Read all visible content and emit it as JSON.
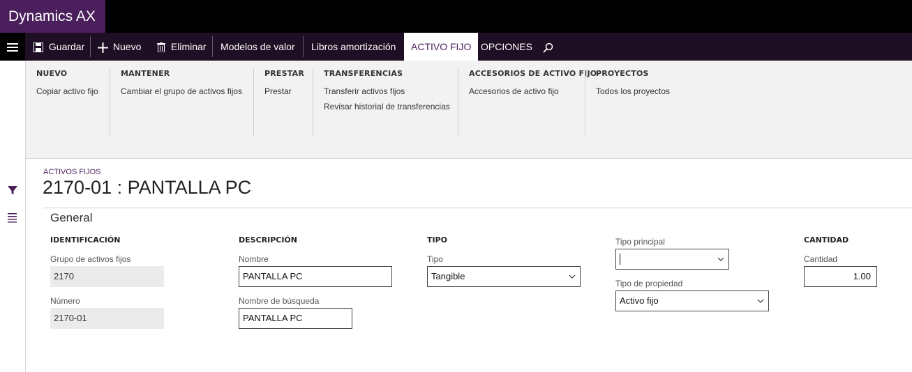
{
  "app": {
    "title": "Dynamics AX"
  },
  "toolbar": {
    "save_label": "Guardar",
    "new_label": "Nuevo",
    "delete_label": "Eliminar",
    "value_models_label": "Modelos de valor",
    "depreciation_books_label": "Libros amortización",
    "tab_active_label": "ACTIVO FIJO",
    "tab_options_label": "OPCIONES"
  },
  "ribbon": {
    "groups": [
      {
        "header": "NUEVO",
        "items": [
          "Copiar activo fijo"
        ]
      },
      {
        "header": "MANTENER",
        "items": [
          "Cambiar el grupo de activos fijos"
        ]
      },
      {
        "header": "PRESTAR",
        "items": [
          "Prestar"
        ]
      },
      {
        "header": "TRANSFERENCIAS",
        "items": [
          "Transferir activos fijos",
          "Revisar historial de transferencias"
        ]
      },
      {
        "header": "ACCESORIOS DE ACTIVO FIJO",
        "items": [
          "Accesorios de activo fijo"
        ]
      },
      {
        "header": "PROYECTOS",
        "items": [
          "Todos los proyectos"
        ]
      }
    ]
  },
  "page": {
    "breadcrumb": "ACTIVOS FIJOS",
    "title": "2170-01 : PANTALLA PC",
    "fasttab": "General"
  },
  "form": {
    "identificacion": {
      "header": "IDENTIFICACIÓN",
      "group_label": "Grupo de activos fijos",
      "group_value": "2170",
      "number_label": "Número",
      "number_value": "2170-01"
    },
    "descripcion": {
      "header": "DESCRIPCIÓN",
      "name_label": "Nombre",
      "name_value": "PANTALLA PC",
      "search_label": "Nombre de búsqueda",
      "search_value": "PANTALLA PC"
    },
    "tipo": {
      "header": "TIPO",
      "type_label": "Tipo",
      "type_value": "Tangible"
    },
    "principal": {
      "main_type_label": "Tipo principal",
      "main_type_value": "",
      "property_type_label": "Tipo de propiedad",
      "property_type_value": "Activo fijo"
    },
    "cantidad": {
      "header": "CANTIDAD",
      "qty_label": "Cantidad",
      "qty_value": "1.00"
    }
  },
  "icons": {
    "hamburger": "hamburger-icon",
    "save": "save-icon",
    "new": "plus-icon",
    "delete": "trash-icon",
    "search": "search-icon",
    "filter": "filter-icon",
    "list": "list-icon",
    "dropdown": "chevron-down-icon"
  },
  "colors": {
    "brand": "#4a1f5c",
    "actionbar": "#1f0f24",
    "ribbon": "#f2f2f2"
  }
}
